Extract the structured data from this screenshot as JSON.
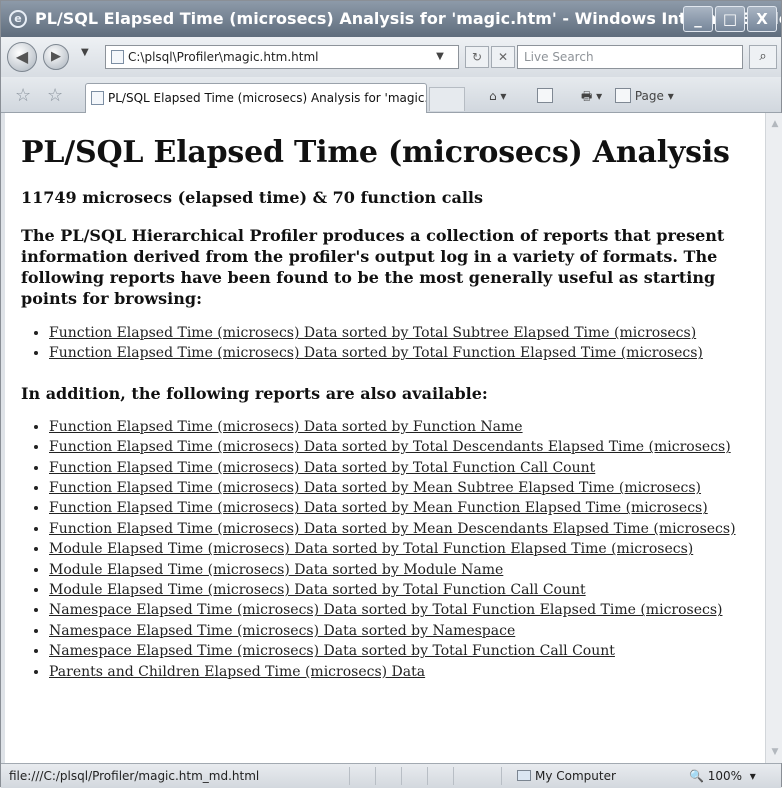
{
  "window": {
    "title": "PL/SQL Elapsed Time (microsecs) Analysis for 'magic.htm' - Windows Internet Explorer",
    "minimize": "_",
    "maximize": "□",
    "close": "X"
  },
  "navbar": {
    "address": "C:\\plsql\\Profiler\\magic.htm.html",
    "search_placeholder": "Live Search",
    "back_glyph": "◀",
    "forward_glyph": "▶",
    "refresh_glyph": "↻",
    "stop_glyph": "✕",
    "search_glyph": "⌕"
  },
  "tabs": {
    "active_label": "PL/SQL Elapsed Time (microsecs) Analysis for 'magic.htm'",
    "page_menu": "Page"
  },
  "content": {
    "heading": "PL/SQL Elapsed Time (microsecs) Analysis",
    "summary": "11749 microsecs (elapsed time) & 70 function calls",
    "intro": "The PL/SQL Hierarchical Profiler produces a collection of reports that present information derived from the profiler's output log in a variety of formats. The following reports have been found to be the most generally useful as starting points for browsing:",
    "primary_reports": [
      "Function Elapsed Time (microsecs) Data sorted by Total Subtree Elapsed Time (microsecs)",
      "Function Elapsed Time (microsecs) Data sorted by Total Function Elapsed Time (microsecs)"
    ],
    "additional_heading": "In addition, the following reports are also available:",
    "additional_reports": [
      "Function Elapsed Time (microsecs) Data sorted by Function Name",
      "Function Elapsed Time (microsecs) Data sorted by Total Descendants Elapsed Time (microsecs)",
      "Function Elapsed Time (microsecs) Data sorted by Total Function Call Count",
      "Function Elapsed Time (microsecs) Data sorted by Mean Subtree Elapsed Time (microsecs)",
      "Function Elapsed Time (microsecs) Data sorted by Mean Function Elapsed Time (microsecs)",
      "Function Elapsed Time (microsecs) Data sorted by Mean Descendants Elapsed Time (microsecs)",
      "Module Elapsed Time (microsecs) Data sorted by Total Function Elapsed Time (microsecs)",
      "Module Elapsed Time (microsecs) Data sorted by Module Name",
      "Module Elapsed Time (microsecs) Data sorted by Total Function Call Count",
      "Namespace Elapsed Time (microsecs) Data sorted by Total Function Elapsed Time (microsecs)",
      "Namespace Elapsed Time (microsecs) Data sorted by Namespace",
      "Namespace Elapsed Time (microsecs) Data sorted by Total Function Call Count",
      "Parents and Children Elapsed Time (microsecs) Data"
    ]
  },
  "statusbar": {
    "url": "file:///C:/plsql/Profiler/magic.htm_md.html",
    "zone": "My Computer",
    "zoom": "100%"
  }
}
